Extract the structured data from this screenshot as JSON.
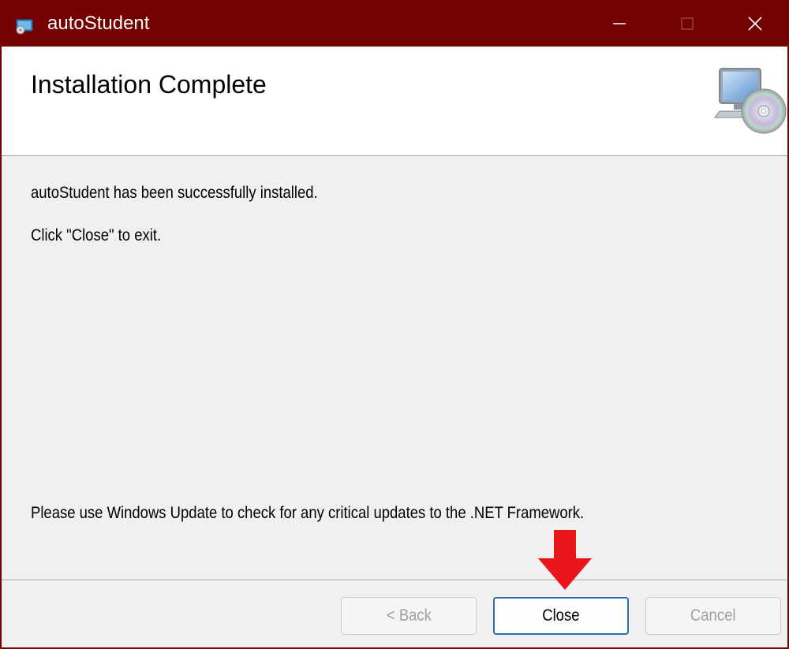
{
  "window": {
    "title": "autoStudent",
    "titlebar_color": "#740000"
  },
  "header": {
    "title": "Installation Complete",
    "icon": "setup-computer-cd-icon"
  },
  "body": {
    "line1": "autoStudent has been successfully installed.",
    "line2": "Click \"Close\" to exit.",
    "line3": "Please use Windows Update to check for any critical updates to the .NET Framework."
  },
  "buttons": {
    "back_label": "< Back",
    "close_label": "Close",
    "cancel_label": "Cancel"
  },
  "annotation": {
    "icon": "red-down-arrow",
    "color": "#e8151b"
  }
}
